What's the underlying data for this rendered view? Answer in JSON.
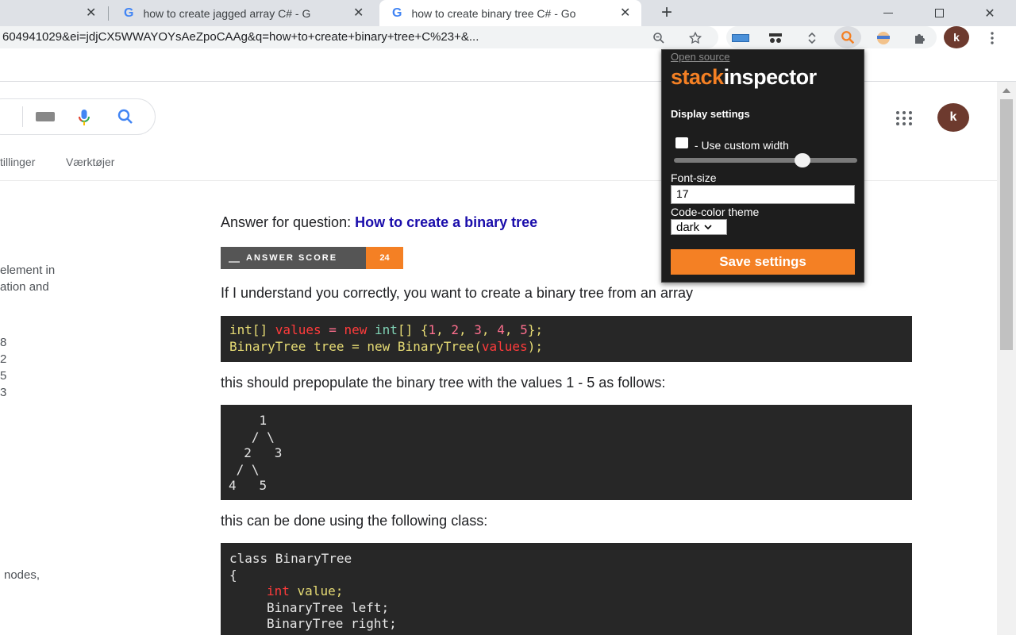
{
  "colors": {
    "accent": "#f48024",
    "link": "#1a0dab",
    "codeBg": "#272727",
    "popupBg": "#1d1d1d"
  },
  "browser": {
    "tabs": [
      {
        "title": "how to create jagged array C# - G",
        "active": false
      },
      {
        "title": "how to create binary tree C# - Go",
        "active": true
      }
    ],
    "new_tab_symbol": "+",
    "url": "604941029&ei=jdjCX5WWAYOYsAeZpoCAAg&q=how+to+create+binary+tree+C%23+&...",
    "profile_initial": "k"
  },
  "google": {
    "nav": [
      "tillinger",
      "Værktøjer"
    ],
    "profile_initial": "k",
    "side_fragments": [
      "element in",
      "ation and",
      "8",
      "2",
      "5",
      "3",
      "nodes,"
    ]
  },
  "answer": {
    "heading_prefix": "Answer for question: ",
    "question_title": "How to create a binary tree",
    "badge_label": "ANSWER SCORE",
    "badge_score": "24",
    "para1": "If I understand you correctly, you want to create a binary tree from an array",
    "para2": "this should prepopulate the binary tree with the values 1 - 5 as follows:",
    "para3": "this can be done using the following class:",
    "code1": {
      "line1": {
        "a": "int[] ",
        "b": "values",
        "c": " = ",
        "d": "new",
        "e": " int",
        "f": "[] {",
        "g": "1",
        "h": ", ",
        "i": "2",
        "j": ", ",
        "k": "3",
        "l": ", ",
        "m": "4",
        "n": ", ",
        "o": "5",
        "p": "};"
      },
      "line2": {
        "a": "BinaryTree tree = new BinaryTree(",
        "b": "values",
        "c": ");"
      }
    },
    "tree_lines": [
      "    1",
      "   / \\",
      "  2   3",
      " / \\",
      "4   5"
    ],
    "code3": {
      "l1": "class BinaryTree",
      "l2": "{",
      "l3a": "int",
      "l3b": " value;",
      "l4": "BinaryTree left;",
      "l5": "BinaryTree right;"
    }
  },
  "popup": {
    "open_source": "Open source",
    "logo_a": "stack",
    "logo_b": "inspector",
    "display_settings": "Display settings",
    "custom_width_label": " - Use custom width",
    "custom_width_checked": false,
    "slider_value": 0.7,
    "font_size_label": "Font-size",
    "font_size_value": "17",
    "theme_label": "Code-color theme",
    "theme_value": "dark",
    "save_label": "Save settings"
  }
}
